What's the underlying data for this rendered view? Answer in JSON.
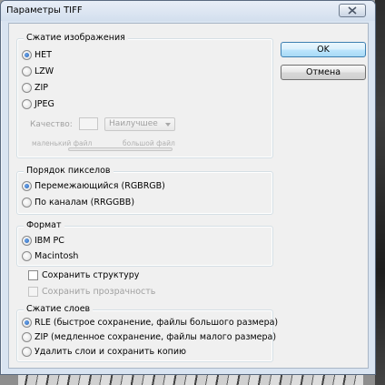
{
  "window": {
    "title": "Параметры TIFF"
  },
  "buttons": {
    "ok": "OK",
    "cancel": "Отмена"
  },
  "compression": {
    "legend": "Сжатие изображения",
    "options": [
      "НЕТ",
      "LZW",
      "ZIP",
      "JPEG"
    ],
    "selected_index": 0,
    "quality_label": "Качество:",
    "quality_value": "",
    "quality_select": "Наилучшее",
    "small_file": "маленький файл",
    "large_file": "большой файл"
  },
  "pixel_order": {
    "legend": "Порядок пикселов",
    "options": [
      "Перемежающийся (RGBRGB)",
      "По каналам (RRGGBB)"
    ],
    "selected_index": 0
  },
  "format": {
    "legend": "Формат",
    "options": [
      "IBM PC",
      "Macintosh"
    ],
    "selected_index": 0
  },
  "checkboxes": {
    "save_structure": "Сохранить структуру",
    "save_transparency": "Сохранить прозрачность"
  },
  "layer_compression": {
    "legend": "Сжатие слоев",
    "options": [
      "RLE (быстрое сохранение, файлы большого размера)",
      "ZIP (медленное сохранение, файлы малого размера)",
      "Удалить слои и сохранить копию"
    ],
    "selected_index": 0
  },
  "colors": {
    "default_button_border": "#3c7fb1",
    "radio_dot": "#1f5fb8",
    "disabled_text": "#a0a0a0"
  }
}
